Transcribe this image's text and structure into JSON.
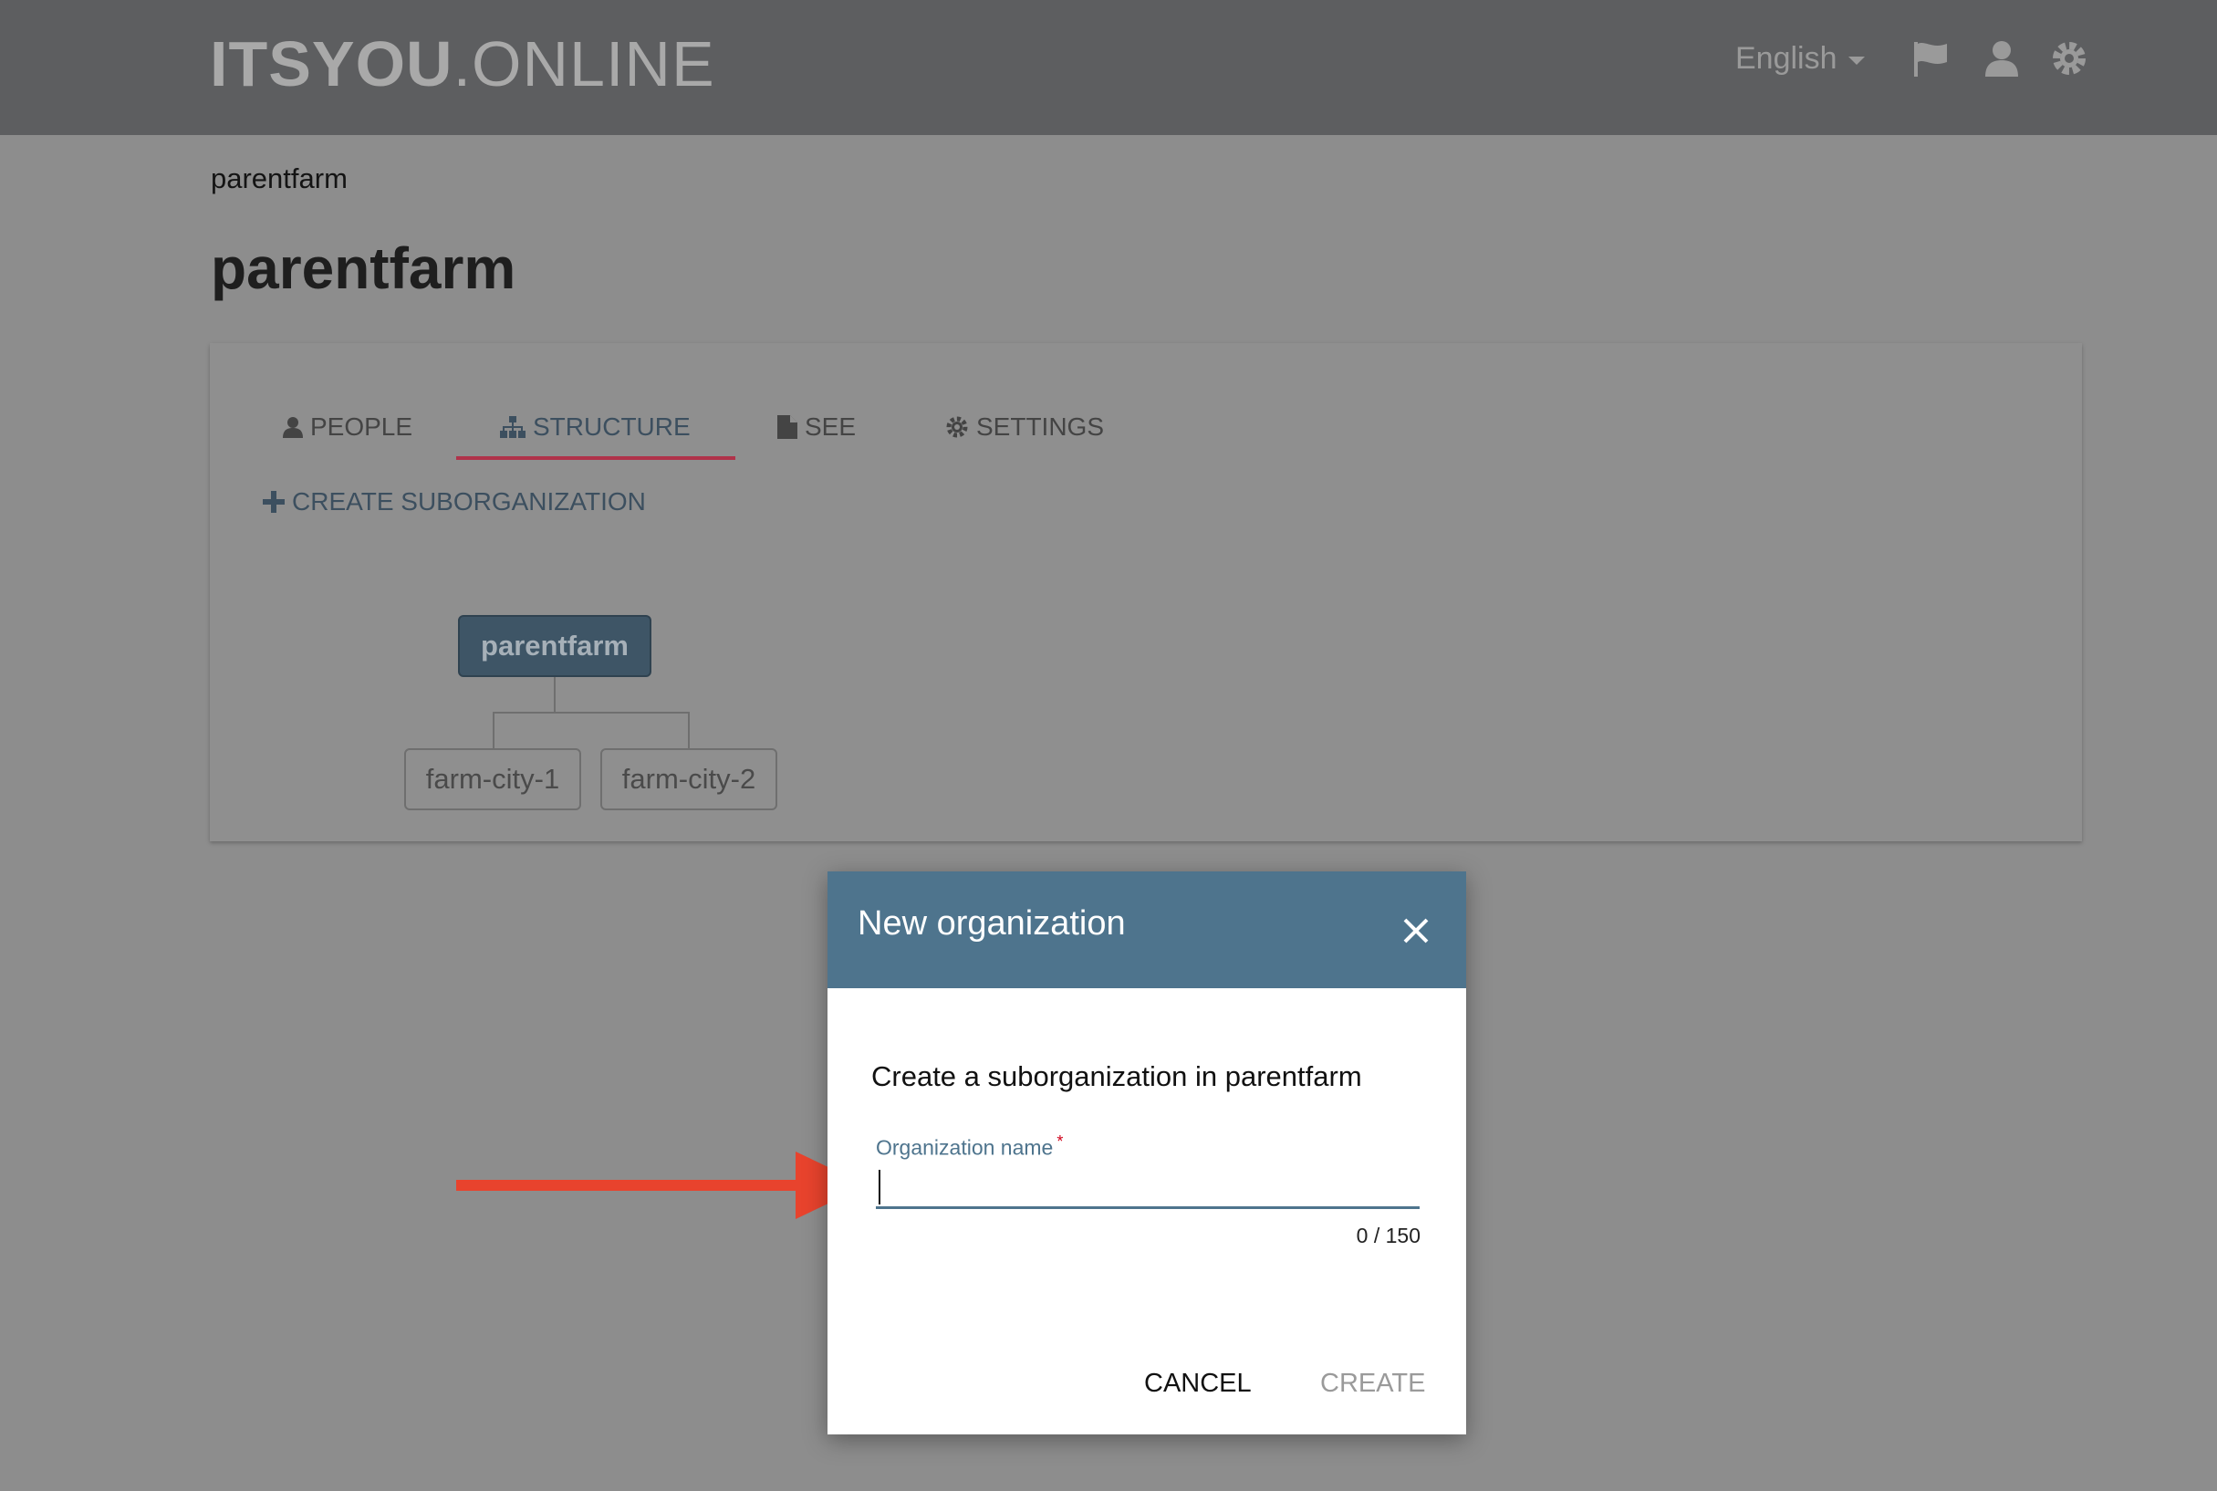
{
  "header": {
    "brand_bold": "ITSYOU",
    "brand_light": ".ONLINE",
    "language": "English",
    "icons": [
      "flag-icon",
      "user-icon",
      "gear-icon"
    ]
  },
  "breadcrumb": "parentfarm",
  "page_title": "parentfarm",
  "tabs": [
    {
      "label": "PEOPLE",
      "icon": "person-icon"
    },
    {
      "label": "STRUCTURE",
      "icon": "sitemap-icon",
      "active": true
    },
    {
      "label": "SEE",
      "icon": "document-icon"
    },
    {
      "label": "SETTINGS",
      "icon": "gear-icon"
    }
  ],
  "create_sub_label": "CREATE SUBORGANIZATION",
  "tree": {
    "root": "parentfarm",
    "children": [
      "farm-city-1",
      "farm-city-2"
    ]
  },
  "modal": {
    "title": "New organization",
    "description": "Create a suborganization in parentfarm",
    "field_label": "Organization name",
    "required_mark": "*",
    "value": "",
    "counter": "0 / 150",
    "cancel": "CANCEL",
    "create": "CREATE"
  },
  "colors": {
    "topbar": "#5d5e60",
    "backdrop": "#8d8d8d",
    "modal_header": "#4e748d",
    "tab_underline": "#b0324a",
    "annotation_arrow": "#e8432d"
  }
}
